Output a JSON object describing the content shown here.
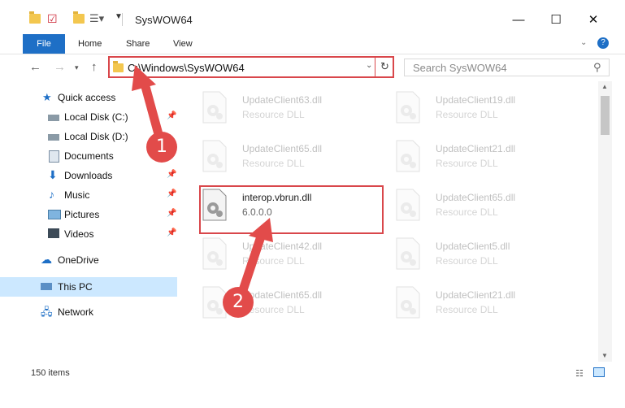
{
  "window": {
    "title": "SysWOW64"
  },
  "ribbon": {
    "tabs": [
      "File",
      "Home",
      "Share",
      "View"
    ]
  },
  "address": {
    "path": "C:\\Windows\\SysWOW64"
  },
  "search": {
    "placeholder": "Search SysWOW64"
  },
  "sidebar": {
    "items": [
      {
        "label": "Quick access",
        "icon": "star-icon"
      },
      {
        "label": "Local Disk (C:)",
        "icon": "drive-icon",
        "pinned": true
      },
      {
        "label": "Local Disk (D:)",
        "icon": "drive-icon"
      },
      {
        "label": "Documents",
        "icon": "documents-icon"
      },
      {
        "label": "Downloads",
        "icon": "download-icon",
        "pinned": true
      },
      {
        "label": "Music",
        "icon": "music-icon",
        "pinned": true
      },
      {
        "label": "Pictures",
        "icon": "pictures-icon",
        "pinned": true
      },
      {
        "label": "Videos",
        "icon": "videos-icon",
        "pinned": true
      },
      {
        "label": "OneDrive",
        "icon": "cloud-icon"
      },
      {
        "label": "This PC",
        "icon": "pc-icon",
        "selected": true
      },
      {
        "label": "Network",
        "icon": "network-icon"
      }
    ]
  },
  "files": [
    {
      "name": "UpdateClient63.dll",
      "desc": "Resource DLL"
    },
    {
      "name": "UpdateClient19.dll",
      "desc": "Resource DLL"
    },
    {
      "name": "UpdateClient65.dll",
      "desc": "Resource DLL"
    },
    {
      "name": "UpdateClient21.dll",
      "desc": "Resource DLL"
    },
    {
      "name": "interop.vbrun.dll",
      "desc": "6.0.0.0"
    },
    {
      "name": "UpdateClient65.dll",
      "desc": "Resource DLL"
    },
    {
      "name": "UpdateClient42.dll",
      "desc": "Resource DLL"
    },
    {
      "name": "UpdateClient5.dll",
      "desc": "Resource DLL"
    },
    {
      "name": "UpdateClient65.dll",
      "desc": "Resource DLL"
    },
    {
      "name": "UpdateClient21.dll",
      "desc": "Resource DLL"
    }
  ],
  "status": {
    "count": "150 items"
  },
  "annotations": {
    "step1": "1",
    "step2": "2"
  },
  "colors": {
    "accent": "#1e6fc6",
    "highlight": "#d9474b",
    "badge": "#e24b4a",
    "selected": "#cce8ff"
  }
}
